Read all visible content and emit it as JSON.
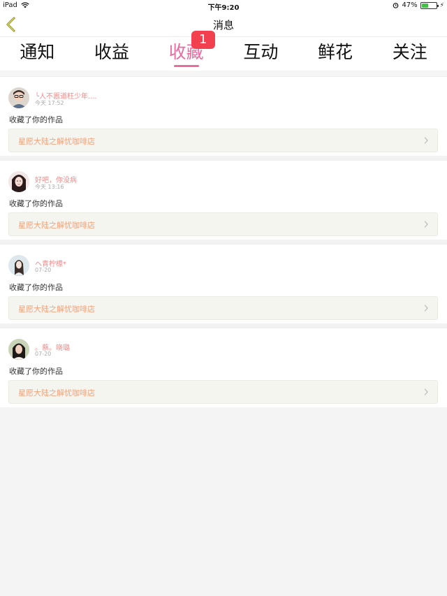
{
  "status_bar": {
    "device": "iPad",
    "time": "下午9:20",
    "battery_text": "47%",
    "battery_level": 0.47
  },
  "nav": {
    "title": "消息"
  },
  "tabs": [
    {
      "label": "通知"
    },
    {
      "label": "收益"
    },
    {
      "label": "收藏",
      "badge": "1"
    },
    {
      "label": "互动"
    },
    {
      "label": "鲜花"
    },
    {
      "label": "关注"
    }
  ],
  "active_tab": "收藏",
  "colors": {
    "accent": "#e96ba0",
    "badge": "#f2404e",
    "username": "#f08a8a",
    "work_title": "#f3a17a"
  },
  "messages": [
    {
      "user": "╰人不嚣道枉少年....",
      "time": "今天 17:52",
      "action": "收藏了你的作品",
      "work": "星愿大陆之解忧咖啡店"
    },
    {
      "user": "好吧，你没病",
      "time": "今天 13:16",
      "action": "收藏了你的作品",
      "work": "星愿大陆之解忧咖啡店"
    },
    {
      "user": "ヘ青柠檬*",
      "time": "07-20",
      "action": "收藏了你的作品",
      "work": "星愿大陆之解忧咖啡店"
    },
    {
      "user": "。蔡。晓璐",
      "time": "07-20",
      "action": "收藏了你的作品",
      "work": "星愿大陆之解忧咖啡店"
    }
  ]
}
